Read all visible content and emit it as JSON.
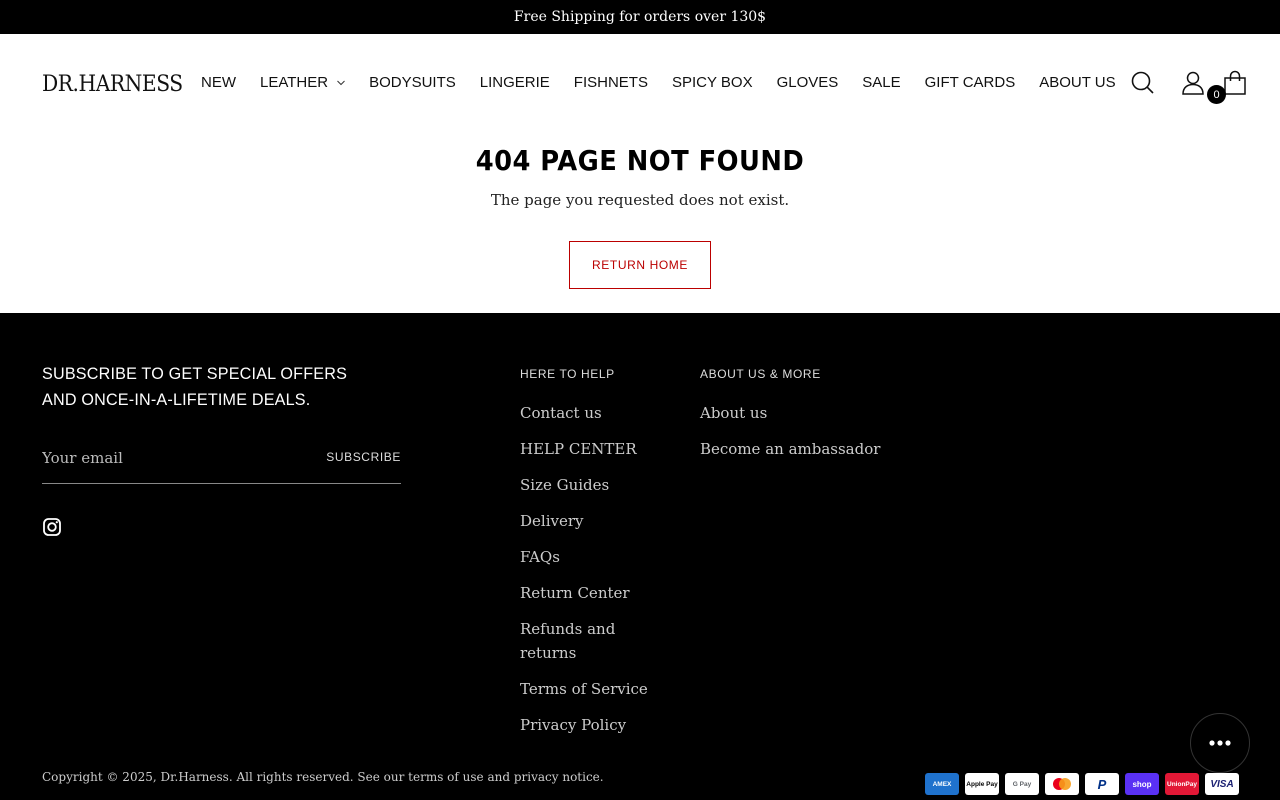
{
  "announcement": "Free Shipping for orders over 130$",
  "header": {
    "logo": "DR.HARNESS",
    "nav": [
      {
        "label": "NEW"
      },
      {
        "label": "LEATHER"
      },
      {
        "label": "BODYSUITS"
      },
      {
        "label": "LINGERIE"
      },
      {
        "label": "FISHNETS"
      },
      {
        "label": "SPICY BOX"
      },
      {
        "label": "GLOVES"
      },
      {
        "label": "SALE"
      },
      {
        "label": "GIFT CARDS"
      },
      {
        "label": "ABOUT US"
      }
    ],
    "cart_count": "0"
  },
  "main": {
    "title": "404 PAGE NOT FOUND",
    "subtitle": "The page you requested does not exist.",
    "return_label": "RETURN HOME"
  },
  "footer": {
    "subscribe_title": "SUBSCRIBE TO GET SPECIAL OFFERS AND ONCE-IN-A-LIFETIME DEALS.",
    "email_placeholder": "Your email",
    "subscribe_label": "SUBSCRIBE",
    "help_heading": "HERE TO HELP",
    "help_links": [
      "Contact us",
      "HELP CENTER",
      "Size Guides",
      "Delivery",
      "FAQs",
      "Return Center",
      "Refunds and returns",
      "Terms of Service",
      "Privacy Policy"
    ],
    "about_heading": "ABOUT US & MORE",
    "about_links": [
      "About us",
      "Become an ambassador"
    ],
    "copyright": "Copyright © 2025, Dr.Harness. All rights reserved. See our terms of use and privacy notice.",
    "payments": [
      {
        "name": "American Express",
        "label": "AMEX",
        "bg": "#1f72cd",
        "fg": "#ffffff"
      },
      {
        "name": "Apple Pay",
        "label": "Apple Pay",
        "bg": "#ffffff",
        "fg": "#000000"
      },
      {
        "name": "Google Pay",
        "label": "G Pay",
        "bg": "#ffffff",
        "fg": "#5f6368"
      },
      {
        "name": "Mastercard",
        "label": "",
        "bg": "#ffffff",
        "fg": "#000000"
      },
      {
        "name": "PayPal",
        "label": "P",
        "bg": "#ffffff",
        "fg": "#003087"
      },
      {
        "name": "Shop Pay",
        "label": "shop",
        "bg": "#5a31f4",
        "fg": "#ffffff"
      },
      {
        "name": "UnionPay",
        "label": "UnionPay",
        "bg": "#e21836",
        "fg": "#ffffff"
      },
      {
        "name": "Visa",
        "label": "VISA",
        "bg": "#ffffff",
        "fg": "#1a1f71"
      }
    ]
  },
  "colors": {
    "accent": "#bb0000",
    "footer_bg": "#000000",
    "announcement_bg": "#000000"
  },
  "icons": [
    "search-icon",
    "account-icon",
    "bag-icon",
    "instagram-icon",
    "chat-icon",
    "chevron-down-icon"
  ]
}
